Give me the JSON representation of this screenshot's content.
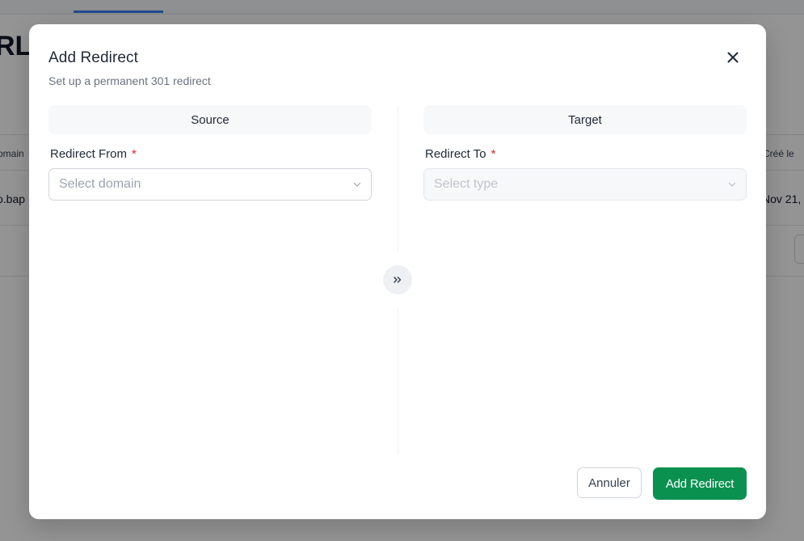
{
  "background": {
    "heading_fragment": "RL I",
    "table": {
      "header_left": "omain",
      "header_right": "Créé le",
      "cell_left": "o.bap",
      "cell_right": "Nov 21,"
    }
  },
  "modal": {
    "title": "Add Redirect",
    "subtitle": "Set up a permanent 301 redirect",
    "close_icon": "close-icon",
    "source": {
      "header": "Source",
      "label": "Redirect From",
      "required_mark": "*",
      "placeholder": "Select domain"
    },
    "target": {
      "header": "Target",
      "label": "Redirect To",
      "required_mark": "*",
      "placeholder": "Select type",
      "disabled": true
    },
    "swap_icon": "chevrons-right-icon",
    "buttons": {
      "cancel_label": "Annuler",
      "submit_label": "Add Redirect"
    }
  },
  "colors": {
    "primary": "#0a9150",
    "required": "#dc2626",
    "overlay": "rgba(0,0,0,0.42)"
  }
}
